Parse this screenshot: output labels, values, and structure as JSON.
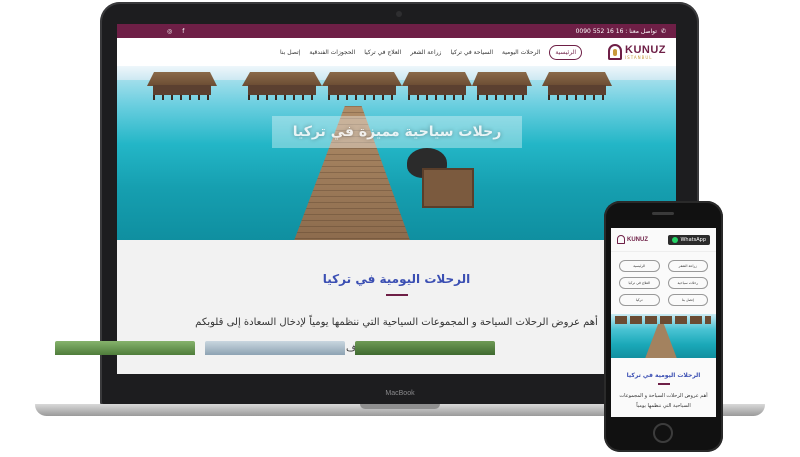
{
  "laptop": {
    "brand_label": "MacBook",
    "site": {
      "topbar": {
        "contact_text": "تواصل معنا : 16 16 552 0090",
        "social": [
          "instagram-icon",
          "facebook-icon"
        ]
      },
      "nav": {
        "logo_main": "KUNUZ",
        "logo_sub": "ISTANBUL",
        "items": [
          "الرئيسية",
          "الرحلات اليومية",
          "السياحة في تركيا",
          "زراعة الشعر",
          "العلاج في تركيا",
          "الحجوزات الفندقية",
          "إتصل بنا"
        ],
        "active_index": 0
      },
      "hero": {
        "title": "رحلات سياحية مميزة في تركيا"
      },
      "section": {
        "title": "الرحلات اليومية في تركيا",
        "paragraph": "أهم عروض الرحلات السياحة و المجموعات السياحية التي ننظمها يومياً لإدخال السعادة إلى قلوبكم وإغناء عشق الإستكشاف"
      }
    }
  },
  "phone": {
    "site": {
      "logo_main": "KUNUZ",
      "logo_sub": "ISTANBUL",
      "whatsapp_label": "WhatsApp",
      "menu": [
        "زراعة الشعر",
        "الرئيسية",
        "رحلات سياحية",
        "العلاج في تركيا",
        "إتصل بنا",
        "تركيا"
      ],
      "section_title": "الرحلات اليومية في تركيا",
      "section_text": "أهم عروض الرحلات السياحة و المجموعات السياحية التي ننظمها يومياً"
    }
  },
  "colors": {
    "brand": "#6e1f46",
    "heading": "#3b4fb3",
    "accent": "#c89b3c"
  }
}
